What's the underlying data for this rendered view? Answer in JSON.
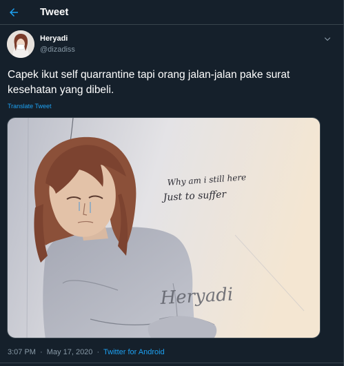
{
  "header": {
    "title": "Tweet",
    "back_icon": "arrow-left-icon"
  },
  "author": {
    "display_name": "Heryadi",
    "handle": "@dizadiss",
    "menu_icon": "chevron-down-icon"
  },
  "tweet": {
    "text": "Capek ikut self quarrantine tapi orang jalan-jalan pake surat kesehatan yang dibeli.",
    "translate_label": "Translate Tweet"
  },
  "media": {
    "handwritten_caption_lines": [
      "Why am i still here",
      "Just to suffer"
    ],
    "signature": "Heryadi"
  },
  "meta": {
    "time": "3:07 PM",
    "separator": "·",
    "date": "May 17, 2020",
    "source": "Twitter for Android"
  },
  "colors": {
    "background": "#15202b",
    "border": "#38444d",
    "text_primary": "#ffffff",
    "text_secondary": "#8899a6",
    "accent": "#1da1f2"
  }
}
